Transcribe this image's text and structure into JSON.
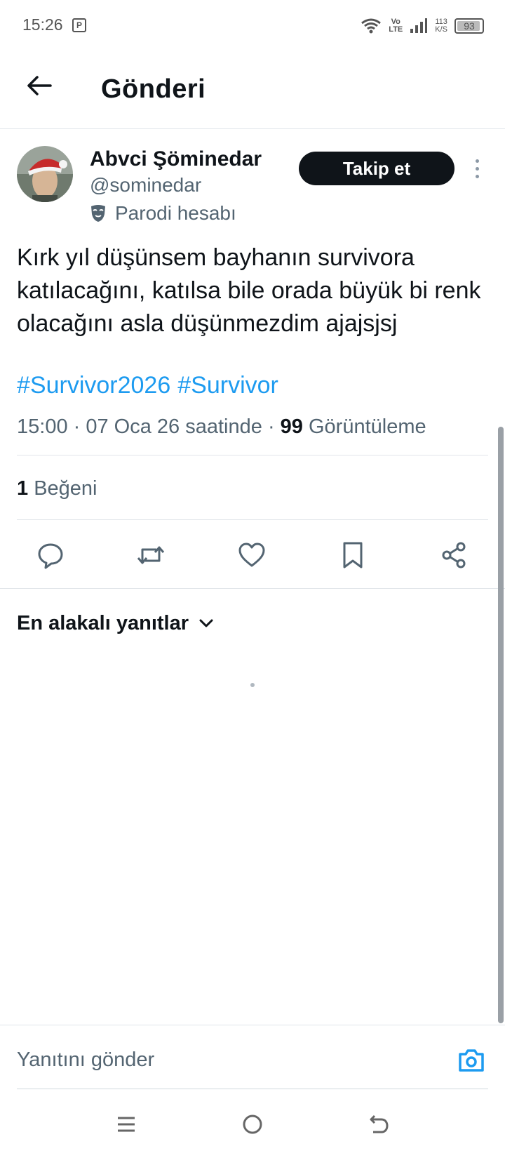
{
  "status_bar": {
    "time": "15:26",
    "app_icon_letter": "P",
    "volte_top": "Vo",
    "volte_bottom": "LTE",
    "net_speed_value": "113",
    "net_speed_unit": "K/S",
    "battery": "93",
    "battery_level": 0.93
  },
  "header": {
    "title": "Gönderi"
  },
  "post": {
    "author_name": "Abvci Şöminedar",
    "author_handle": "@sominedar",
    "account_label": "Parodi hesabı",
    "follow_label": "Takip et",
    "text": "Kırk yıl düşünsem bayhanın survivora katılacağını, katılsa bile orada büyük bi renk olacağını asla düşünmezdim ajajsjsj",
    "hashtags": [
      "#Survivor2026",
      "#Survivor"
    ],
    "time": "15:00",
    "date": "07 Oca 26 saatinde",
    "views_count": "99",
    "views_label": "Görüntüleme",
    "likes_count": "1",
    "likes_label": "Beğeni",
    "actions": [
      "reply-icon",
      "retweet-icon",
      "like-icon",
      "bookmark-icon",
      "share-icon"
    ]
  },
  "replies": {
    "sort_label": "En alakalı yanıtlar"
  },
  "reply_composer": {
    "placeholder": "Yanıtını gönder"
  },
  "colors": {
    "accent": "#1d9bf0",
    "text_primary": "#0f1419",
    "text_secondary": "#536471",
    "follow_bg": "#0f1419",
    "divider": "#e1e5ea"
  }
}
